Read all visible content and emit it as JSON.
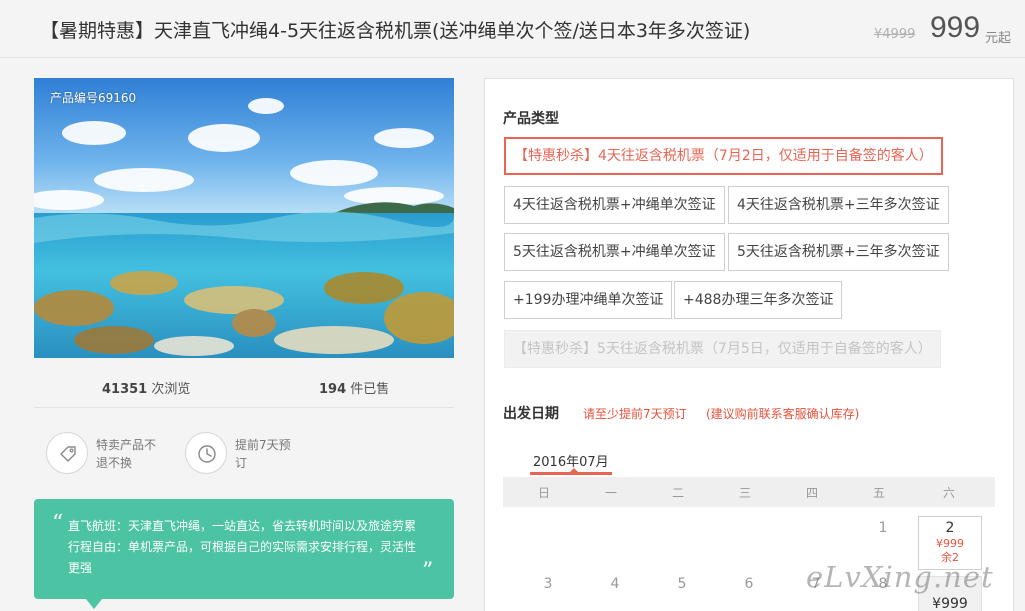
{
  "header": {
    "title": "【暑期特惠】天津直飞冲绳4-5天往返含税机票(送冲绳单次个签/送日本3年多次签证)",
    "old_price": "¥4999",
    "price": "999",
    "price_unit": "元起"
  },
  "product": {
    "code": "产品编号69160",
    "views_count": "41351",
    "views_label": "次浏览",
    "sold_count": "194",
    "sold_label": "件已售"
  },
  "features": [
    {
      "icon": "tag-icon",
      "text": "特卖产品不退不换"
    },
    {
      "icon": "clock-icon",
      "text": "提前7天预订"
    }
  ],
  "quote": {
    "open": "“",
    "close": "”",
    "text": "直飞航班：天津直飞冲绳，一站直达，省去转机时间以及旅途劳累 行程自由：单机票产品，可根据自己的实际需求安排行程，灵活性更强"
  },
  "booking": {
    "type_label": "产品类型",
    "options": [
      {
        "label": "【特惠秒杀】4天往返含税机票（7月2日，仅适用于自备签的客人）",
        "state": "active"
      },
      {
        "label": "4天往返含税机票+冲绳单次签证",
        "state": "normal"
      },
      {
        "label": "4天往返含税机票+三年多次签证",
        "state": "normal"
      },
      {
        "label": "5天往返含税机票+冲绳单次签证",
        "state": "normal"
      },
      {
        "label": "5天往返含税机票+三年多次签证",
        "state": "normal"
      },
      {
        "label": "+199办理冲绳单次签证",
        "state": "normal"
      },
      {
        "label": "+488办理三年多次签证",
        "state": "normal"
      },
      {
        "label": "【特惠秒杀】5天往返含税机票（7月5日，仅适用于自备签的客人）",
        "state": "disabled"
      }
    ],
    "date_label": "出发日期",
    "tip1": "请至少提前7天预订",
    "tip2": "(建议购前联系客服确认库存)",
    "month": "2016年07月",
    "weekdays": [
      "日",
      "一",
      "二",
      "三",
      "四",
      "五",
      "六"
    ],
    "row1_day_fri": "1",
    "row1_day_sat": "2",
    "row1_price": "¥999",
    "row1_stock": "余2",
    "row2_days": [
      "3",
      "4",
      "5",
      "6",
      "7",
      "8"
    ],
    "row2_price": "¥999"
  },
  "watermark": "eLvXing.net",
  "colors": {
    "accent": "#e96552",
    "quote_bg": "#4cc4a3",
    "tip": "#e5533c"
  }
}
